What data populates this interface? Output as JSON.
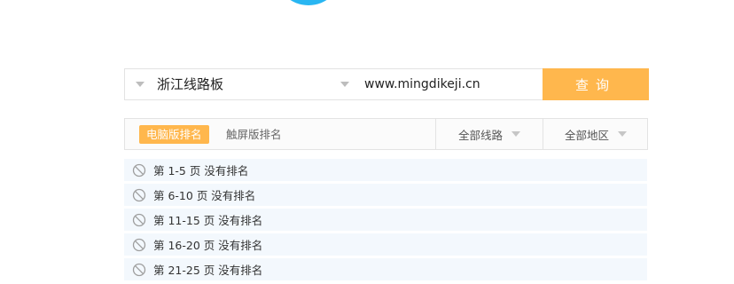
{
  "search": {
    "keyword": "浙江线路板",
    "site": "www.mingdikeji.cn",
    "query_label": "查询"
  },
  "filters": {
    "tab_pc": "电脑版排名",
    "tab_touch": "触屏版排名",
    "line_select": "全部线路",
    "area_select": "全部地区"
  },
  "results": [
    "第 1-5 页 没有排名",
    "第 6-10 页 没有排名",
    "第 11-15 页 没有排名",
    "第 16-20 页 没有排名",
    "第 21-25 页 没有排名"
  ],
  "colors": {
    "accent": "#ffb74d",
    "logo": "#29b6f2",
    "row_bg": "#f3f8fd"
  }
}
